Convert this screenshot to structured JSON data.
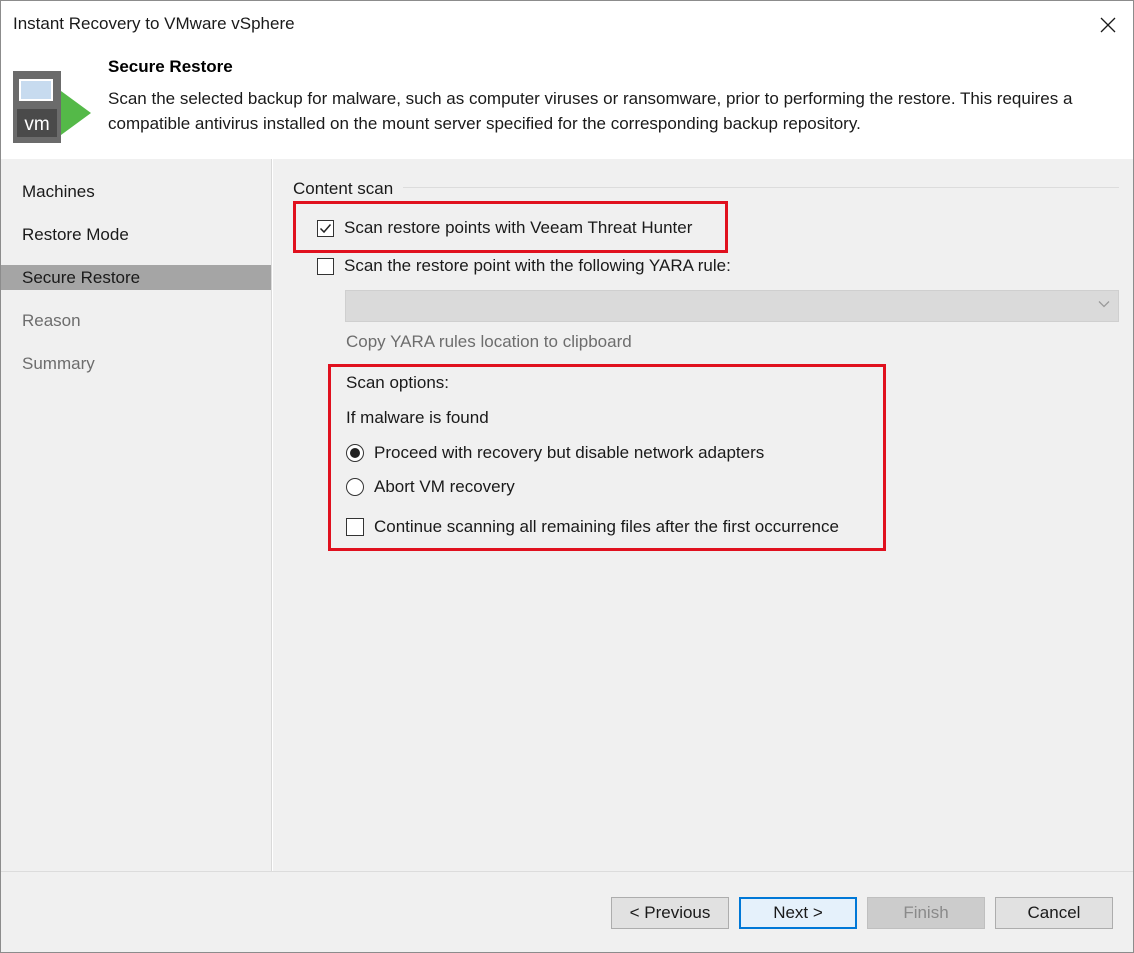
{
  "window": {
    "title": "Instant Recovery to VMware vSphere",
    "close_icon": "close-icon"
  },
  "header": {
    "title": "Secure Restore",
    "description": "Scan the selected backup for malware, such as computer viruses or ransomware, prior to performing the restore. This requires a compatible antivirus installed on the mount server specified for the corresponding backup repository.",
    "icon": "vm-icon"
  },
  "sidebar": {
    "items": [
      {
        "label": "Machines",
        "state": "enabled"
      },
      {
        "label": "Restore Mode",
        "state": "enabled"
      },
      {
        "label": "Secure Restore",
        "state": "active"
      },
      {
        "label": "Reason",
        "state": "disabled"
      },
      {
        "label": "Summary",
        "state": "disabled"
      }
    ]
  },
  "content": {
    "section_label": "Content scan",
    "threat_hunter": {
      "label": "Scan restore points with Veeam Threat Hunter",
      "checked": true
    },
    "yara": {
      "label": "Scan the restore point with the following YARA rule:",
      "checked": false,
      "selected_value": ""
    },
    "copy_link": "Copy YARA rules location to clipboard",
    "scan_options": {
      "heading": "Scan options:",
      "subheading": "If malware is found",
      "radio_options": [
        {
          "label": "Proceed with recovery but disable network adapters",
          "selected": true
        },
        {
          "label": "Abort VM recovery",
          "selected": false
        }
      ],
      "continue_scanning": {
        "label": "Continue scanning all remaining files after the first occurrence",
        "checked": false
      }
    },
    "highlight_color": "#e0101e"
  },
  "footer": {
    "previous": "< Previous",
    "next": "Next >",
    "finish": "Finish",
    "cancel": "Cancel"
  }
}
